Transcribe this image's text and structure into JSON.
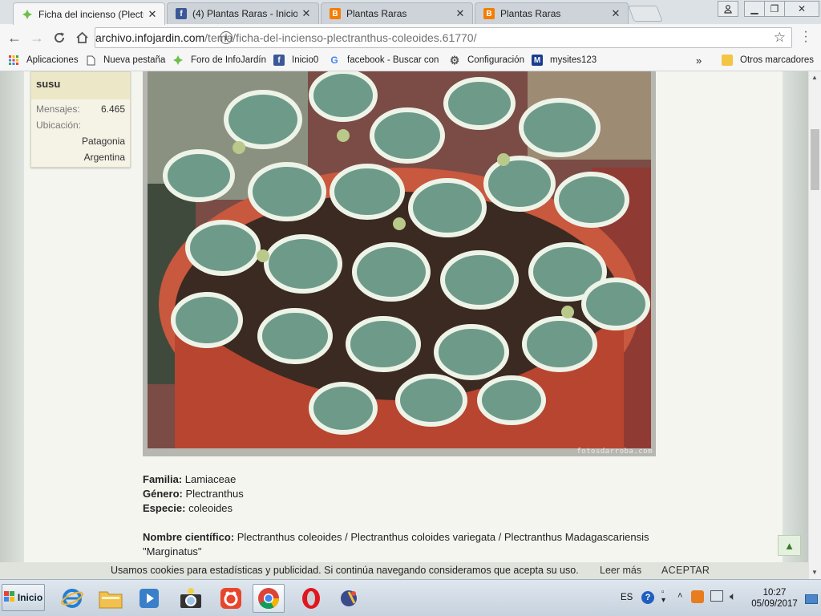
{
  "tabs": [
    {
      "title": "Ficha del incienso (Plectran",
      "icon": "infojardin-leaf-icon",
      "active": true
    },
    {
      "title": "(4) Plantas Raras - Inicio",
      "icon": "facebook-icon",
      "active": false
    },
    {
      "title": "Plantas Raras",
      "icon": "blogger-icon",
      "active": false
    },
    {
      "title": "Plantas Raras",
      "icon": "blogger-icon",
      "active": false
    }
  ],
  "address_bar": {
    "url_host": "archivo.infojardin.com",
    "url_path": "/tema/ficha-del-incienso-plectranthus-coleoides.61770/"
  },
  "bookmarks": [
    {
      "label": "Aplicaciones",
      "icon": "apps-grid-icon"
    },
    {
      "label": "Nueva pestaña",
      "icon": "page-icon"
    },
    {
      "label": "Foro de InfoJardín",
      "icon": "infojardin-leaf-icon"
    },
    {
      "label": "Inicio0",
      "icon": "facebook-icon"
    },
    {
      "label": "facebook - Buscar con",
      "icon": "google-icon"
    },
    {
      "label": "Configuración",
      "icon": "gear-icon"
    },
    {
      "label": "mysites123",
      "icon": "m-icon"
    }
  ],
  "bookmarks_overflow": "»",
  "other_bookmarks": "Otros marcadores",
  "user": {
    "name": "susu",
    "messages_label": "Mensajes:",
    "messages_value": "6.465",
    "location_label": "Ubicación:",
    "location_line1": "Patagonia",
    "location_line2": "Argentina"
  },
  "photo_credit": "fotosdarroba.com",
  "plant": {
    "familia_label": "Familia:",
    "familia": "Lamiaceae",
    "genero_label": "Género:",
    "genero": "Plectranthus",
    "especie_label": "Especie:",
    "especie": "coleoides",
    "cientifico_label": "Nombre científico:",
    "cientifico": "Plectranthus coleoides / Plectranthus coloides variegata / Plectranthus Madagascariensis",
    "cientifico_cont": "\"Marginatus\""
  },
  "cookie_bar": {
    "message": "Usamos cookies para estadísticas y publicidad. Si continúa navegando consideramos que acepta su uso.",
    "more": "Leer más",
    "accept": "ACEPTAR"
  },
  "taskbar": {
    "start": "Inicio",
    "lang": "ES",
    "time": "10:27",
    "date": "05/09/2017"
  },
  "colors": {
    "facebook": "#3b5998",
    "blogger": "#f57d00",
    "infojardin": "#6cc04a"
  }
}
